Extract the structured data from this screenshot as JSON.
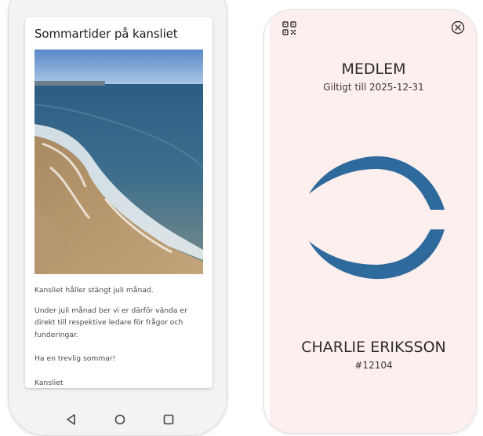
{
  "news": {
    "title": "Sommartider på kansliet",
    "image_icon": "beach-photo",
    "paragraphs": [
      "Kansliet håller stängt juli månad.",
      "Under juli månad ber vi er därför vända er direkt till respektive ledare för frågor och funderingar.",
      "Ha en trevlig sommar!",
      "Kansliet"
    ]
  },
  "navigation": {
    "back_icon": "back-triangle-icon",
    "home_icon": "home-circle-icon",
    "recents_icon": "recents-square-icon"
  },
  "membership": {
    "type": "MEDLEM",
    "valid_until": "Giltigt till 2025-12-31",
    "name": "CHARLIE ERIKSSON",
    "number": "#12104",
    "qr_icon": "qr-code-icon",
    "close_icon": "close-circle-icon",
    "logo_color": "#2f6a9c",
    "background_color": "#fdefee"
  }
}
